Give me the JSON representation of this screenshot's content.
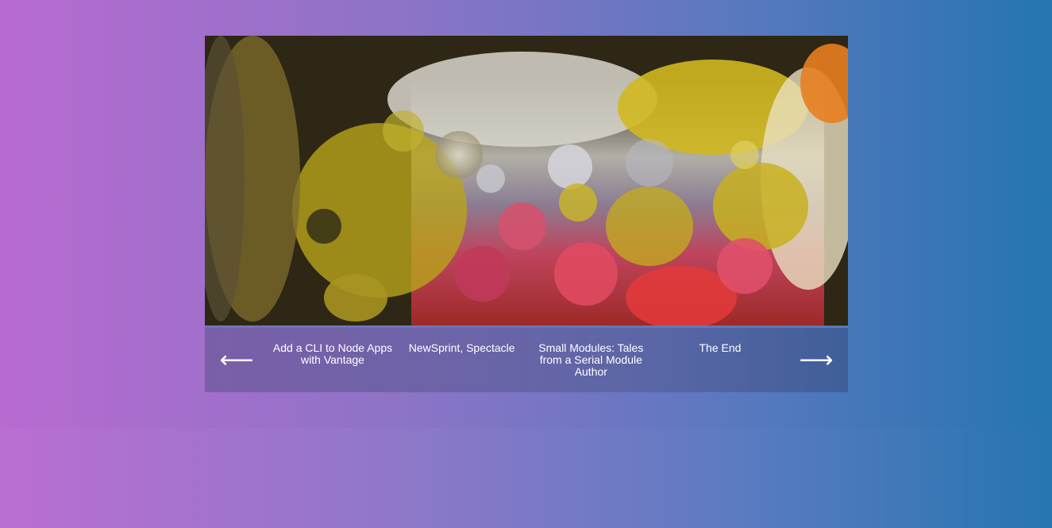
{
  "slider": {
    "image_icon": "abstract-oil-water-bubbles-photo",
    "prev_arrow": "⟵",
    "next_arrow": "⟶",
    "items": [
      {
        "label": "Add a CLI to Node Apps with Vantage"
      },
      {
        "label": "NewSprint, Spectacle"
      },
      {
        "label": "Small Modules: Tales from a Serial Module Author"
      },
      {
        "label": "The End"
      }
    ]
  },
  "colors": {
    "background_left": "#b86ad0",
    "background_right": "#2475b0",
    "nav_bar": "#6c64a8"
  }
}
